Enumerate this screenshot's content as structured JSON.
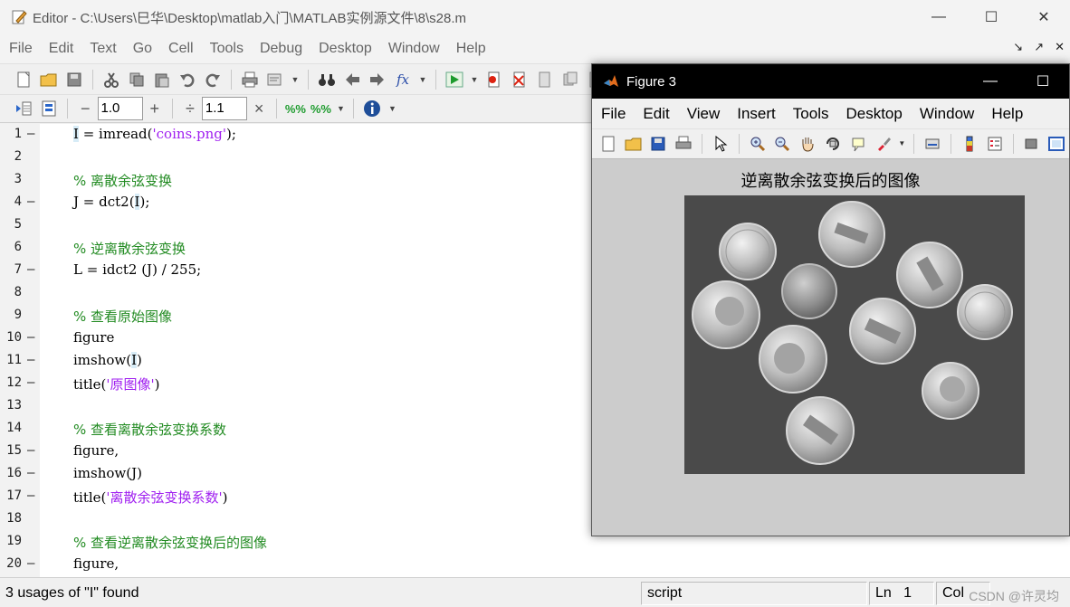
{
  "editor": {
    "title": "Editor - C:\\Users\\巳华\\Desktop\\matlab入门\\MATLAB实例源文件\\8\\s28.m",
    "menu": [
      "File",
      "Edit",
      "Text",
      "Go",
      "Cell",
      "Tools",
      "Debug",
      "Desktop",
      "Window",
      "Help"
    ],
    "cell_toolbar": {
      "decrement": "−",
      "value1": "1.0",
      "increment": "+",
      "divide": "÷",
      "value2": "1.1",
      "multiply": "×"
    },
    "lines": [
      {
        "num": "1",
        "dash": "—",
        "text": "I = imread('coins.png');"
      },
      {
        "num": "2",
        "dash": "",
        "text": ""
      },
      {
        "num": "3",
        "dash": "",
        "text": "% 离散余弦变换"
      },
      {
        "num": "4",
        "dash": "—",
        "text": "J = dct2(I);"
      },
      {
        "num": "5",
        "dash": "",
        "text": ""
      },
      {
        "num": "6",
        "dash": "",
        "text": "% 逆离散余弦变换"
      },
      {
        "num": "7",
        "dash": "—",
        "text": "L = idct2 (J) / 255;"
      },
      {
        "num": "8",
        "dash": "",
        "text": ""
      },
      {
        "num": "9",
        "dash": "",
        "text": "% 查看原始图像"
      },
      {
        "num": "10",
        "dash": "—",
        "text": "figure"
      },
      {
        "num": "11",
        "dash": "—",
        "text": "imshow(I)"
      },
      {
        "num": "12",
        "dash": "—",
        "text": "title('原图像')"
      },
      {
        "num": "13",
        "dash": "",
        "text": ""
      },
      {
        "num": "14",
        "dash": "",
        "text": "% 查看离散余弦变换系数"
      },
      {
        "num": "15",
        "dash": "—",
        "text": "figure,"
      },
      {
        "num": "16",
        "dash": "—",
        "text": "imshow(J)"
      },
      {
        "num": "17",
        "dash": "—",
        "text": "title('离散余弦变换系数')"
      },
      {
        "num": "18",
        "dash": "",
        "text": ""
      },
      {
        "num": "19",
        "dash": "",
        "text": "% 查看逆离散余弦变换后的图像"
      },
      {
        "num": "20",
        "dash": "—",
        "text": "figure,"
      }
    ],
    "status": {
      "message": "3 usages of \"I\" found",
      "mode": "script",
      "ln_label": "Ln",
      "ln_value": "1",
      "col_label": "Col"
    },
    "watermark": "CSDN @许灵均"
  },
  "figure": {
    "title": "Figure 3",
    "menu": [
      "File",
      "Edit",
      "View",
      "Insert",
      "Tools",
      "Desktop",
      "Window",
      "Help"
    ],
    "plot_title": "逆离散余弦变换后的图像"
  },
  "colors": {
    "comment": "#228b22",
    "string": "#a020f0",
    "figure_titlebar": "#000000",
    "figure_bg": "#cccccc"
  }
}
